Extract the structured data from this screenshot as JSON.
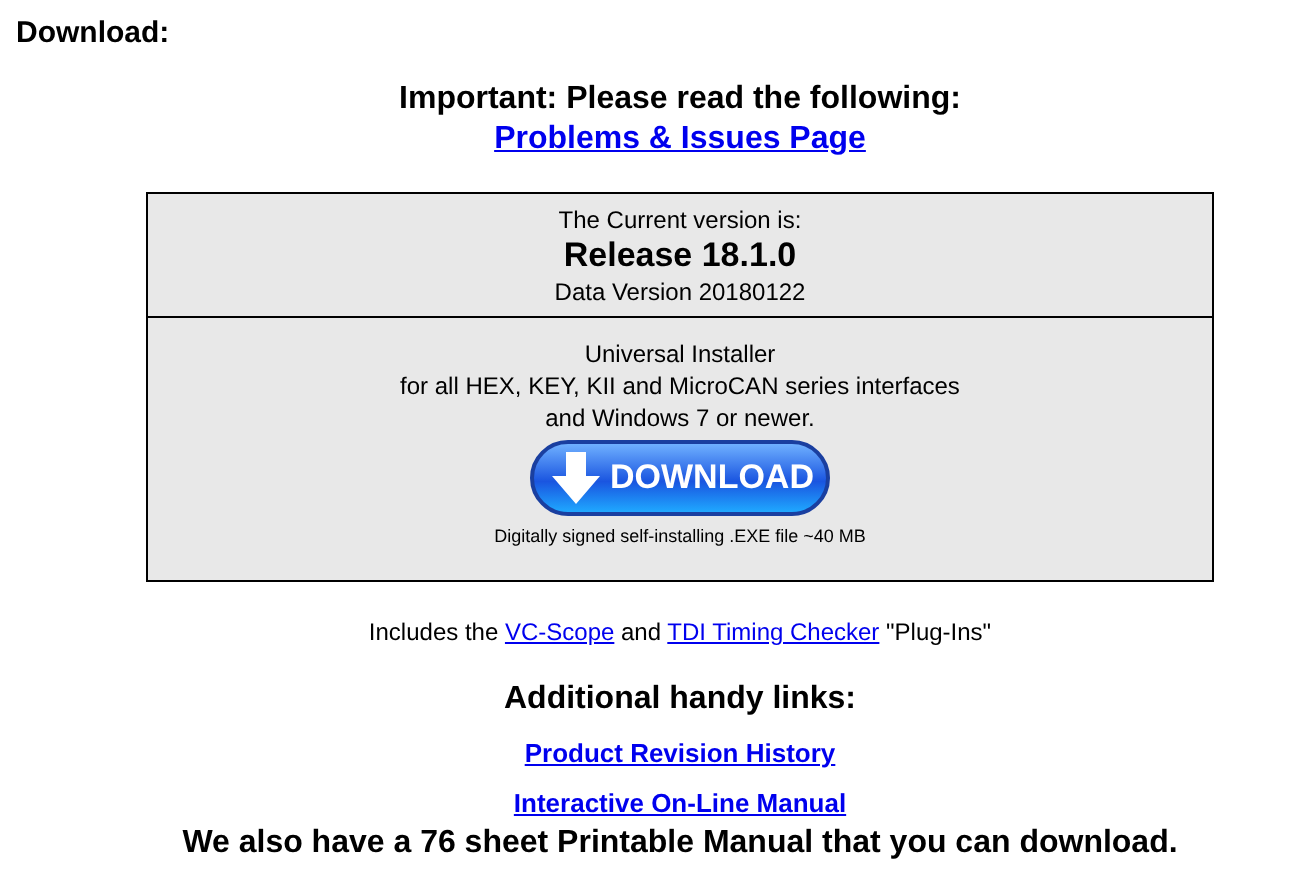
{
  "heading": "Download:",
  "notice": {
    "title": "Important: Please read the following:",
    "link": "Problems & Issues Page"
  },
  "version_box": {
    "caption": "The Current version is:",
    "release": "Release 18.1.0",
    "data_version": "Data Version 20180122"
  },
  "installer": {
    "lines": [
      "Universal Installer",
      "for all HEX, KEY, KII and MicroCAN series interfaces",
      "and Windows 7 or newer."
    ],
    "button": "DOWNLOAD",
    "note": "Digitally signed self-installing .EXE file ~40 MB"
  },
  "includes": [
    {
      "kind": "text",
      "text": "Includes the "
    },
    {
      "kind": "link",
      "text": "VC-Scope"
    },
    {
      "kind": "text",
      "text": " and "
    },
    {
      "kind": "link",
      "text": "TDI Timing Checker"
    },
    {
      "kind": "text",
      "text": " \"Plug-Ins\""
    }
  ],
  "links_title": "Additional handy links:",
  "links": [
    "Product Revision History",
    "Interactive On-Line Manual"
  ],
  "footer": "We also have a 76 sheet Printable Manual that you can download."
}
